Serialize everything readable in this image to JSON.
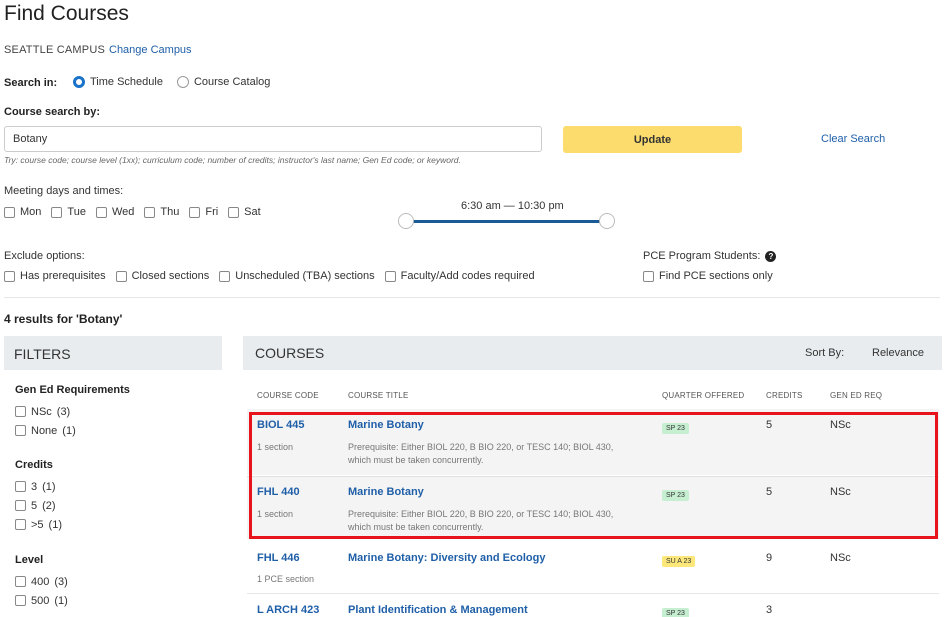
{
  "page": {
    "title": "Find Courses"
  },
  "campus": {
    "name": "SEATTLE CAMPUS",
    "change_label": "Change Campus"
  },
  "search_in": {
    "label": "Search in:",
    "options": [
      {
        "label": "Time Schedule",
        "selected": true
      },
      {
        "label": "Course Catalog",
        "selected": false
      }
    ]
  },
  "search": {
    "label": "Course search by:",
    "value": "Botany",
    "hint": "Try: course code; course level (1xx); curriculum code; number of credits; instructor's last name; Gen Ed code; or keyword.",
    "update_label": "Update",
    "clear_label": "Clear Search"
  },
  "meeting": {
    "label": "Meeting days and times:",
    "days": [
      "Mon",
      "Tue",
      "Wed",
      "Thu",
      "Fri",
      "Sat"
    ],
    "time_range": "6:30 am — 10:30 pm"
  },
  "exclude": {
    "label": "Exclude options:",
    "options": [
      "Has prerequisites",
      "Closed sections",
      "Unscheduled (TBA) sections",
      "Faculty/Add codes required"
    ]
  },
  "pce": {
    "label": "PCE Program Students:",
    "option": "Find PCE sections only"
  },
  "results": {
    "count_text": "4 results for 'Botany'"
  },
  "filters": {
    "heading": "FILTERS",
    "gen_ed": {
      "title": "Gen Ed Requirements",
      "options": [
        {
          "label": "NSc",
          "count": "(3)"
        },
        {
          "label": "None",
          "count": "(1)"
        }
      ]
    },
    "credits": {
      "title": "Credits",
      "options": [
        {
          "label": "3",
          "count": "(1)"
        },
        {
          "label": "5",
          "count": "(2)"
        },
        {
          "label": ">5",
          "count": "(1)"
        }
      ]
    },
    "level": {
      "title": "Level",
      "options": [
        {
          "label": "400",
          "count": "(3)"
        },
        {
          "label": "500",
          "count": "(1)"
        }
      ]
    }
  },
  "courses": {
    "heading": "COURSES",
    "sort_label": "Sort By:",
    "sort_value": "Relevance",
    "columns": [
      "COURSE CODE",
      "COURSE TITLE",
      "QUARTER OFFERED",
      "CREDITS",
      "GEN ED REQ"
    ],
    "rows": [
      {
        "code": "BIOL 445",
        "sections": "1 section",
        "title": "Marine Botany",
        "prereq": "Prerequisite: Either BIOL 220, B BIO 220, or TESC 140; BIOL 430, which must be taken concurrently.",
        "quarter": "SP 23",
        "credits": "5",
        "gen_ed": "NSc"
      },
      {
        "code": "FHL 440",
        "sections": "1 section",
        "title": "Marine Botany",
        "prereq": "Prerequisite: Either BIOL 220, B BIO 220, or TESC 140; BIOL 430, which must be taken concurrently.",
        "quarter": "SP 23",
        "credits": "5",
        "gen_ed": "NSc"
      },
      {
        "code": "FHL 446",
        "sections": "1 PCE section",
        "title": "Marine Botany: Diversity and Ecology",
        "prereq": "",
        "quarter": "SU A 23",
        "credits": "9",
        "gen_ed": "NSc"
      },
      {
        "code": "L ARCH 423",
        "sections": "",
        "title": "Plant Identification & Management",
        "prereq": "",
        "quarter": "SP 23",
        "credits": "3",
        "gen_ed": ""
      }
    ]
  },
  "colors": {
    "link": "#1f5fa8",
    "update_button": "#fbdc6d",
    "highlight": "#e8141b",
    "badge_spring": "#c6eed1",
    "badge_summer": "#fce77a"
  }
}
